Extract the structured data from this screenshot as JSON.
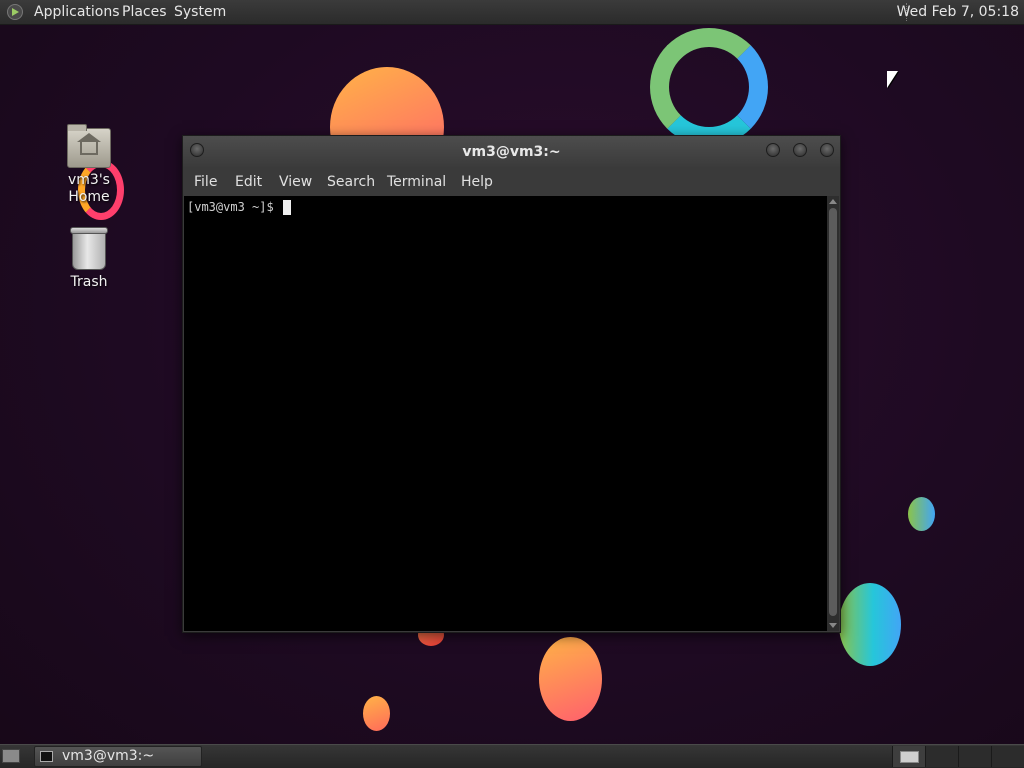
{
  "top_panel": {
    "menus": [
      "Applications",
      "Places",
      "System"
    ],
    "clock": "Wed Feb  7, 05:18",
    "logo_icon": "distro-logo-icon"
  },
  "desktop": {
    "icons": [
      {
        "label": "vm3's Home",
        "icon": "home-folder-icon"
      },
      {
        "label": "Trash",
        "icon": "trash-icon"
      }
    ]
  },
  "window": {
    "title": "vm3@vm3:~",
    "menus": [
      "File",
      "Edit",
      "View",
      "Search",
      "Terminal",
      "Help"
    ],
    "terminal": {
      "prompt": "[vm3@vm3 ~]$ "
    }
  },
  "bottom_panel": {
    "task_label": "vm3@vm3:~",
    "workspaces": 4,
    "active_workspace": 1
  },
  "colors": {
    "panel": "#2f2f2f",
    "desktop_bg": "#1e0a22",
    "terminal_bg": "#000000",
    "terminal_fg": "#d0d0d0"
  }
}
